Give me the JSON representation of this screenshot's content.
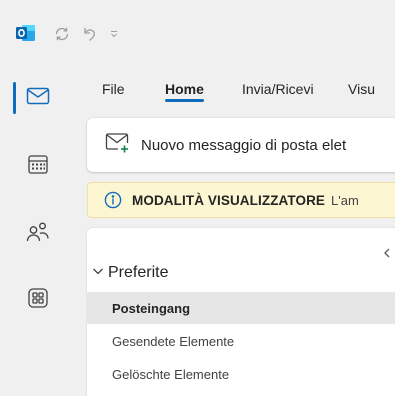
{
  "quick_access": {
    "app_icon": "outlook-icon",
    "sync_icon": "sync-icon",
    "undo_icon": "undo-icon",
    "customize_icon": "chevron-down-icon"
  },
  "nav_rail": {
    "items": [
      {
        "icon": "mail-icon",
        "active": true
      },
      {
        "icon": "calendar-icon",
        "active": false
      },
      {
        "icon": "people-icon",
        "active": false
      },
      {
        "icon": "apps-icon",
        "active": false
      }
    ],
    "accent_color": "#0f6cbd"
  },
  "ribbon_tabs": [
    {
      "label": "File",
      "active": false
    },
    {
      "label": "Home",
      "active": true
    },
    {
      "label": "Invia/Ricevi",
      "active": false
    },
    {
      "label": "Visu",
      "active": false
    }
  ],
  "ribbon": {
    "new_message_label": "Nuovo messaggio di posta elet",
    "new_message_icon": "new-mail-icon"
  },
  "infobar": {
    "icon": "info-icon",
    "title": "MODALITÀ VISUALIZZATORE",
    "text": "L'am",
    "background": "#fdf6d3"
  },
  "folder_pane": {
    "collapse_icon": "chevron-left-icon",
    "favorites_label": "Preferite",
    "folders": [
      {
        "label": "Posteingang",
        "selected": true
      },
      {
        "label": "Gesendete Elemente",
        "selected": false
      },
      {
        "label": "Gelöschte Elemente",
        "selected": false
      }
    ]
  }
}
